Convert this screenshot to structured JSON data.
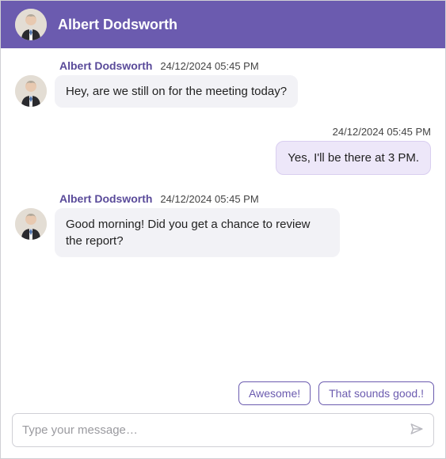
{
  "header": {
    "contact_name": "Albert Dodsworth"
  },
  "messages": [
    {
      "direction": "in",
      "sender": "Albert Dodsworth",
      "timestamp": "24/12/2024 05:45 PM",
      "text": "Hey, are we still on for the meeting today?"
    },
    {
      "direction": "out",
      "timestamp": "24/12/2024 05:45 PM",
      "text": "Yes, I'll be there at 3 PM."
    },
    {
      "direction": "in",
      "sender": "Albert Dodsworth",
      "timestamp": "24/12/2024 05:45 PM",
      "text": "Good morning! Did you get a chance to review the report?"
    }
  ],
  "quick_replies": [
    "Awesome!",
    "That sounds good.!"
  ],
  "composer": {
    "placeholder": "Type your message…"
  },
  "colors": {
    "accent": "#6B5BAF",
    "outgoing_bubble": "#EDE7F9"
  }
}
